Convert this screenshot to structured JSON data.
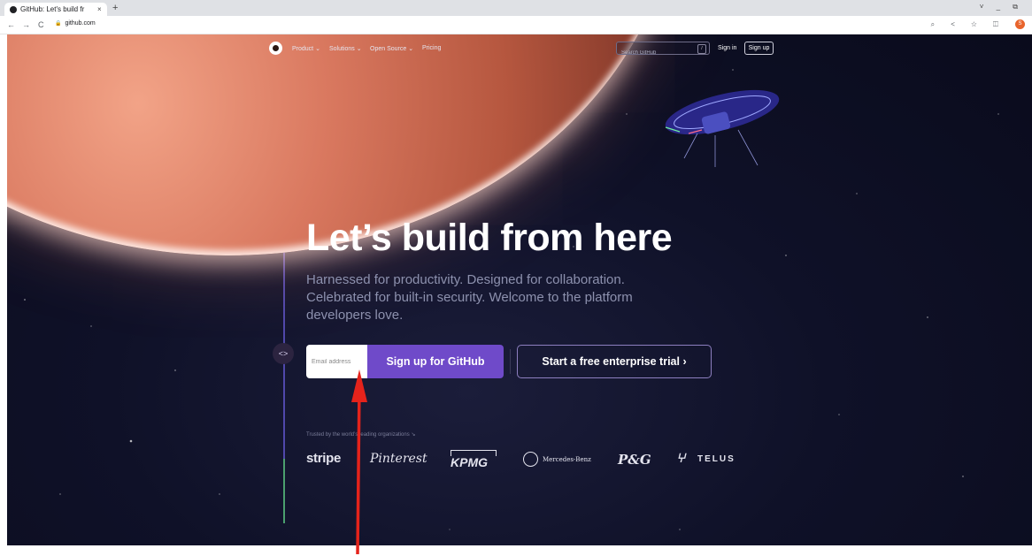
{
  "browser": {
    "tab_title": "GitHub: Let's build fr",
    "tab_close": "×",
    "new_tab": "+",
    "window_controls": "˅ _ ⧉",
    "back": "←",
    "forward": "→",
    "reload": "C",
    "lock": "🔒",
    "url": "github.com",
    "toolbar_icons": "⌕ < ☆ ◫",
    "profile_initial": "S"
  },
  "site_nav": {
    "items": [
      "Product ⌄",
      "Solutions ⌄",
      "Open Source ⌄",
      "Pricing"
    ],
    "search_placeholder": "Search GitHub",
    "search_key": "/",
    "sign_in": "Sign in",
    "sign_up": "Sign up"
  },
  "hero": {
    "title": "Let’s build from here",
    "subtitle": "Harnessed for productivity. Designed for collaboration. Celebrated for built-in security. Welcome to the platform developers love.",
    "code_badge": "<>",
    "email_placeholder": "Email address",
    "signup_button": "Sign up for GitHub",
    "enterprise_button": "Start a free enterprise trial ›"
  },
  "trusted": {
    "label": "Trusted by the world’s leading organizations ↘",
    "logos": [
      "stripe",
      "Pinterest",
      "KPMG",
      "Mercedes-Benz",
      "P&G",
      "TELUS"
    ]
  },
  "colors": {
    "primary_button": "#6f4ac9",
    "annotation_arrow": "#e5231b",
    "background": "#0d0f24"
  }
}
